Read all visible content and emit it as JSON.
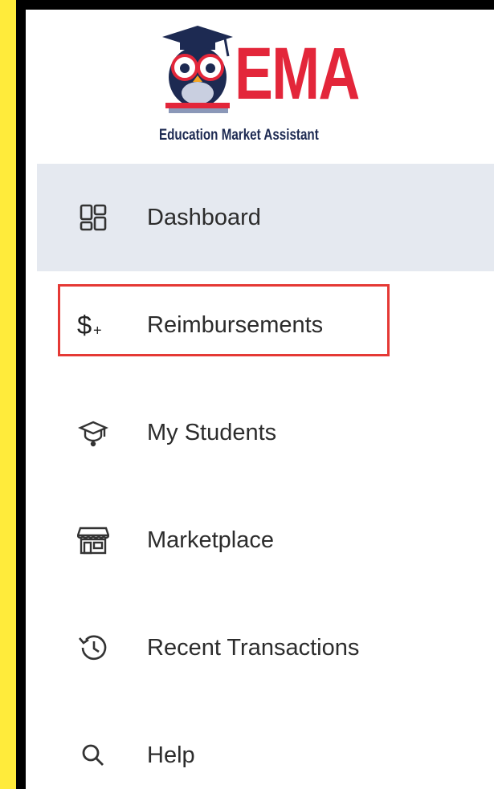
{
  "logo": {
    "title": "EMA",
    "subtitle": "Education Market Assistant"
  },
  "nav": {
    "items": [
      {
        "label": "Dashboard",
        "icon": "dashboard-icon",
        "active": true
      },
      {
        "label": "Reimbursements",
        "icon": "dollar-plus-icon",
        "active": false
      },
      {
        "label": "My Students",
        "icon": "graduation-cap-icon",
        "active": false
      },
      {
        "label": "Marketplace",
        "icon": "storefront-icon",
        "active": false
      },
      {
        "label": "Recent Transactions",
        "icon": "history-icon",
        "active": false
      },
      {
        "label": "Help",
        "icon": "search-icon",
        "active": false
      }
    ]
  },
  "colors": {
    "background": "#FFEB3B",
    "active_bg": "#E5E9F0",
    "brand_red": "#E3263A",
    "highlight_border": "#E53935"
  }
}
